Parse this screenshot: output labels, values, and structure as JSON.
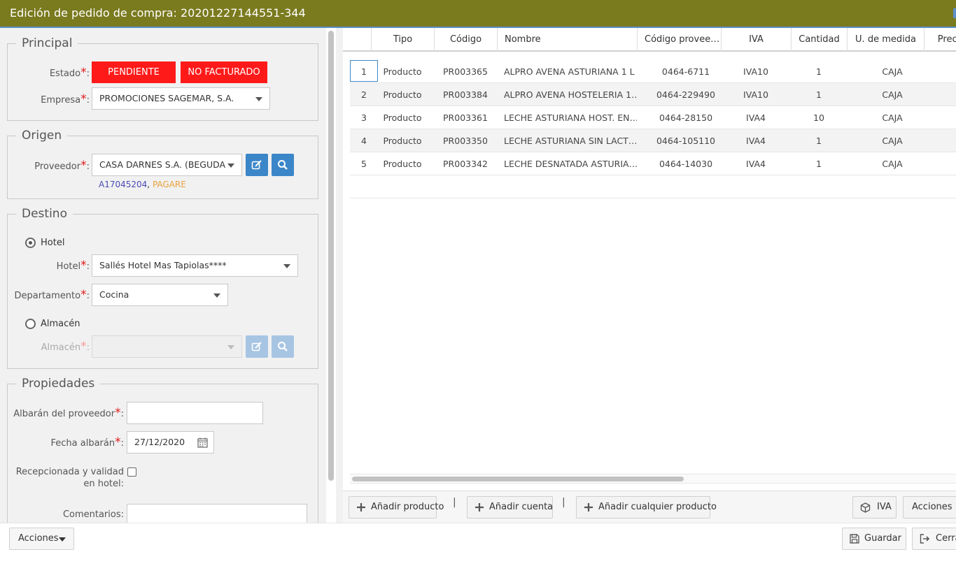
{
  "window": {
    "title": "Edición de pedido de compra: 20201227144551-344"
  },
  "principal": {
    "legend": "Principal",
    "estado_label": "Estado",
    "estado_badges": [
      "PENDIENTE",
      "NO FACTURADO"
    ],
    "empresa_label": "Empresa",
    "empresa_value": "PROMOCIONES SAGEMAR, S.A."
  },
  "origen": {
    "legend": "Origen",
    "proveedor_label": "Proveedor",
    "proveedor_value": "CASA DARNES S.A. (BEGUDA",
    "proveedor_code": "A17045204",
    "proveedor_sep": ",",
    "proveedor_payment": "PAGARE"
  },
  "destino": {
    "legend": "Destino",
    "hotel_radio_label": "Hotel",
    "hotel_label": "Hotel",
    "hotel_value": "Sallés Hotel Mas Tapiolas****",
    "departamento_label": "Departamento",
    "departamento_value": "Cocina",
    "almacen_radio_label": "Almacén",
    "almacen_label": "Almacén",
    "almacen_value": ""
  },
  "propiedades": {
    "legend": "Propiedades",
    "albaran_label": "Albarán del proveedor",
    "albaran_value": "",
    "fecha_label": "Fecha albarán",
    "fecha_value": "27/12/2020",
    "recepcionada_label_1": "Recepcionada y validad",
    "recepcionada_label_2": "en hotel:",
    "comentarios_label": "Comentarios:"
  },
  "grid": {
    "columns": [
      "",
      "Tipo",
      "Código",
      "Nombre",
      "Código provee…",
      "IVA",
      "Cantidad",
      "U. de medida",
      "Preci"
    ],
    "rows": [
      {
        "n": "1",
        "tipo": "Producto",
        "codigo": "PR003365",
        "nombre": "ALPRO AVENA ASTURIANA 1 L",
        "prov": "0464-6711",
        "iva": "IVA10",
        "cantidad": "1",
        "um": "CAJA"
      },
      {
        "n": "2",
        "tipo": "Producto",
        "codigo": "PR003384",
        "nombre": "ALPRO AVENA HOSTELERIA 1…",
        "prov": "0464-229490",
        "iva": "IVA10",
        "cantidad": "1",
        "um": "CAJA"
      },
      {
        "n": "3",
        "tipo": "Producto",
        "codigo": "PR003361",
        "nombre": "LECHE ASTURIANA HOST. EN…",
        "prov": "0464-28150",
        "iva": "IVA4",
        "cantidad": "10",
        "um": "CAJA"
      },
      {
        "n": "4",
        "tipo": "Producto",
        "codigo": "PR003350",
        "nombre": "LECHE ASTURIANA SIN LACT…",
        "prov": "0464-105110",
        "iva": "IVA4",
        "cantidad": "1",
        "um": "CAJA"
      },
      {
        "n": "5",
        "tipo": "Producto",
        "codigo": "PR003342",
        "nombre": "LECHE DESNATADA ASTURIA…",
        "prov": "0464-14030",
        "iva": "IVA4",
        "cantidad": "1",
        "um": "CAJA"
      }
    ]
  },
  "toolbar": {
    "add_product": "Añadir producto",
    "sep": "|",
    "add_account": "Añadir cuenta",
    "add_any": "Añadir cualquier producto",
    "iva": "IVA",
    "actions": "Acciones"
  },
  "footer": {
    "actions": "Acciones",
    "save": "Guardar",
    "close": "Cerrar"
  },
  "colors": {
    "titlebar": "#7a7a1e",
    "badge": "#ff1a1a",
    "primary": "#3b86c8",
    "required": "#e01b1b",
    "link": "#4a4ab8",
    "payment": "#e8a23c"
  }
}
